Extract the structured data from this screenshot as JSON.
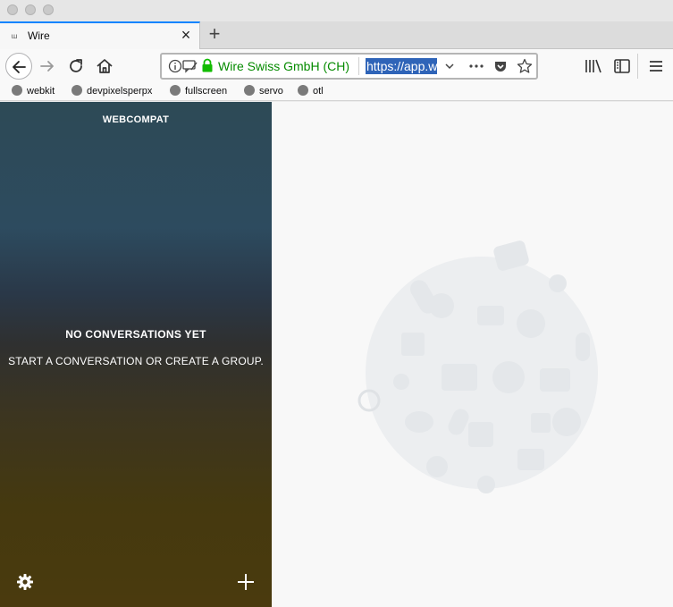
{
  "browser": {
    "tab": {
      "title": "Wire",
      "favicon": "wire-logo"
    },
    "url": {
      "company": "Wire Swiss GmbH (CH)",
      "text": "https://app.wire.com"
    },
    "bookmarks": [
      "webkit",
      "devpixelsperpx",
      "fullscreen",
      "servo",
      "otl"
    ]
  },
  "sidebar": {
    "team_name": "WEBCOMPAT",
    "empty_title": "NO CONVERSATIONS YET",
    "empty_subtitle": "START A CONVERSATION OR CREATE A GROUP."
  },
  "colors": {
    "accent": "#0a84ff",
    "secure": "#12bc00"
  }
}
